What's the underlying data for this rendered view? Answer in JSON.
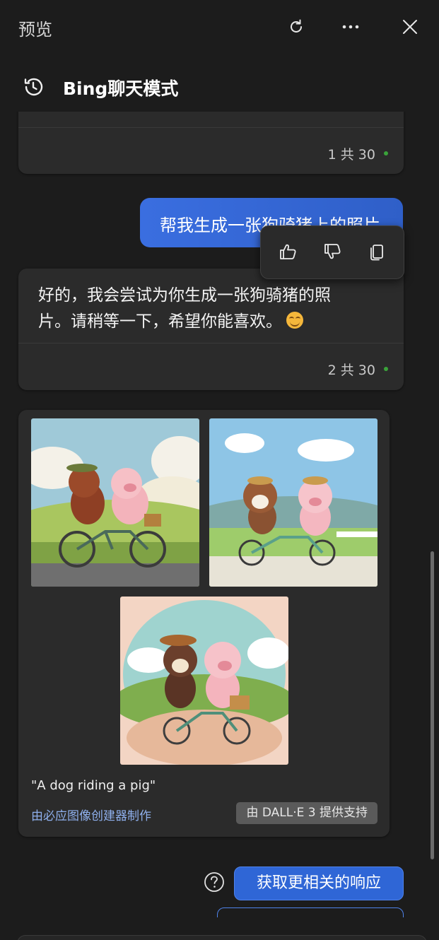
{
  "window": {
    "title": "预览",
    "refresh_icon": "refresh-icon",
    "more_icon": "more-icon",
    "close_icon": "close-icon"
  },
  "header": {
    "history_icon": "history-icon",
    "title": "Bing聊天模式"
  },
  "messages": {
    "prev_counter": "1 共 30",
    "user_message": "帮我生成一张狗骑猪上的照片",
    "actions": {
      "like_icon": "thumbs-up-icon",
      "dislike_icon": "thumbs-down-icon",
      "copy_icon": "copy-icon"
    },
    "bot_reply": {
      "line1": "好的，我会尝试为你生成一张狗骑猪的照",
      "line2": "片。请稍等一下，希望你能喜欢。",
      "emoji": "smiling-face-icon",
      "counter": "2 共 30"
    }
  },
  "image_card": {
    "images": [
      "dog-and-pig-on-bicycle-image-1",
      "dog-and-pig-on-bicycle-image-2",
      "dog-and-pig-on-bicycle-image-3"
    ],
    "caption": "\"A dog riding a pig\"",
    "creator_link": "由必应图像创建器制作",
    "powered_by": "由 DALL·E 3 提供支持"
  },
  "suggestions": {
    "help_icon": "help-icon",
    "items": [
      "获取更相关的响应"
    ]
  },
  "colors": {
    "background": "#1c1c1c",
    "card": "#2b2b2b",
    "user_bubble": "#3a6ee0",
    "accent_button": "#2f66d6",
    "link": "#8fb0ee"
  }
}
